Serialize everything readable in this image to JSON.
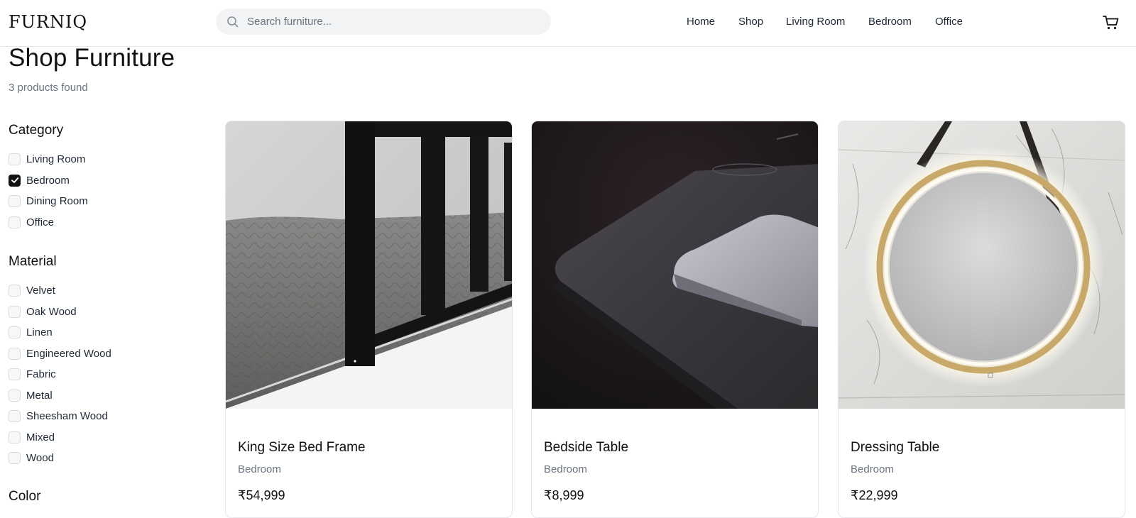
{
  "header": {
    "logo": "FURNIQ",
    "search_placeholder": "Search furniture...",
    "nav": [
      "Home",
      "Shop",
      "Living Room",
      "Bedroom",
      "Office"
    ],
    "icons": {
      "search": "search-icon",
      "cart": "cart-icon"
    }
  },
  "page": {
    "title": "Shop Furniture",
    "result_count": "3 products found"
  },
  "filters": {
    "category": {
      "heading": "Category",
      "options": [
        {
          "label": "Living Room",
          "checked": false
        },
        {
          "label": "Bedroom",
          "checked": true
        },
        {
          "label": "Dining Room",
          "checked": false
        },
        {
          "label": "Office",
          "checked": false
        }
      ]
    },
    "material": {
      "heading": "Material",
      "options": [
        {
          "label": "Velvet",
          "checked": false
        },
        {
          "label": "Oak Wood",
          "checked": false
        },
        {
          "label": "Linen",
          "checked": false
        },
        {
          "label": "Engineered Wood",
          "checked": false
        },
        {
          "label": "Fabric",
          "checked": false
        },
        {
          "label": "Metal",
          "checked": false
        },
        {
          "label": "Sheesham Wood",
          "checked": false
        },
        {
          "label": "Mixed",
          "checked": false
        },
        {
          "label": "Wood",
          "checked": false
        }
      ]
    },
    "color": {
      "heading": "Color"
    }
  },
  "products": [
    {
      "name": "King Size Bed Frame",
      "category": "Bedroom",
      "price": "₹54,999"
    },
    {
      "name": "Bedside Table",
      "category": "Bedroom",
      "price": "₹8,999"
    },
    {
      "name": "Dressing Table",
      "category": "Bedroom",
      "price": "₹22,999"
    }
  ],
  "colors": {
    "accent": "#111111",
    "muted_text": "#6b7280",
    "search_bg": "#f2f3f5",
    "border": "#e5e7eb"
  }
}
